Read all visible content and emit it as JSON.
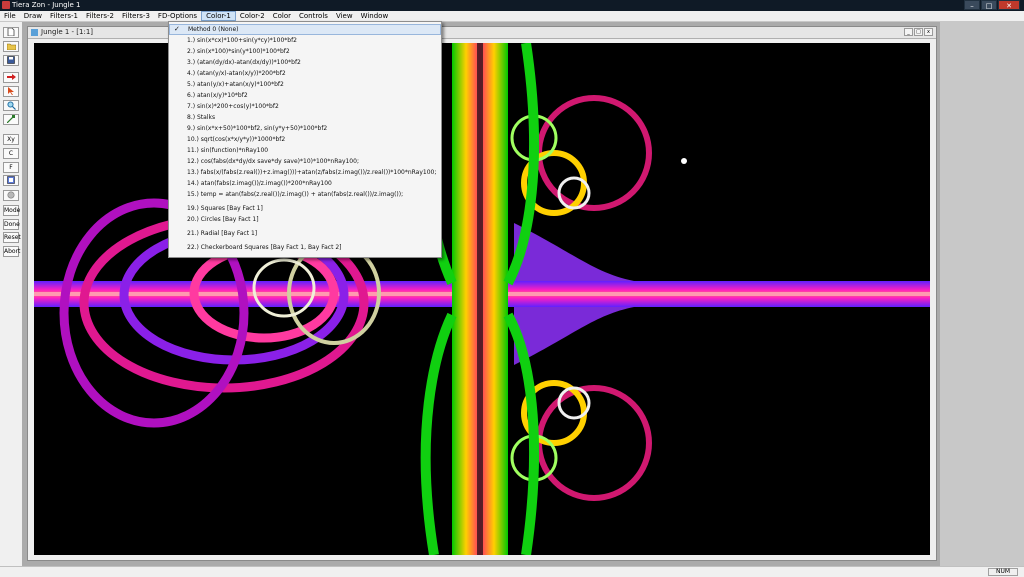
{
  "window": {
    "title": "Tiera Zon - Jungle 1",
    "min": "–",
    "max": "□",
    "close": "✕"
  },
  "menubar": [
    "File",
    "Draw",
    "Filters-1",
    "Filters-2",
    "Filters-3",
    "FD-Options",
    "Color-1",
    "Color-2",
    "Color",
    "Controls",
    "View",
    "Window"
  ],
  "toolbar": [
    "",
    "",
    "",
    "",
    "",
    "",
    "",
    "Xy",
    "C",
    "F",
    "",
    "",
    "Mode",
    "Done",
    "Reset",
    "Abort"
  ],
  "document": {
    "title": "Jungle 1 - [1:1]"
  },
  "color1_menu": {
    "items": [
      "Method 0 (None)",
      "1.) sin(x*cx)*100+sin(y*cy)*100*bf2",
      "2.) sin(x*100)*sin(y*100)*100*bf2",
      "3.) (atan(dy/dx)-atan(dx/dy))*100*bf2",
      "4.) (atan(y/x)-atan(x/y))*200*bf2",
      "5.) atan(y/x)+atan(x/y)*100*bf2",
      "6.) atan(x/y)*10*bf2",
      "7.) sin(x)*200+cos(y)*100*bf2",
      "8.) Stalks",
      "9.) sin(x*x+50)*100*bf2, sin(y*y+50)*100*bf2",
      "10.) sqrt(cos(x*x/y*y))*1000*bf2",
      "11.) sin(function)*nRay100",
      "12.) cos(fabs(dx*dy/dx save*dy save)*10)*100*nRay100;",
      "13.) fabs(x/(fabs(z.real())+z.imag()))+atan(z/fabs(z.imag())/z.real())*100*nRay100;",
      "14.) atan(fabs(z.imag())/z.imag())*200*nRay100",
      "15.) temp = atan(fabs(z.real())/z.imag()) + atan(fabs(z.real())/z.imag());",
      "19.) Squares [Bay Fact 1]",
      "20.) Circles [Bay Fact 1]",
      "21.) Radial [Bay Fact 1]",
      "22.) Checkerboard Squares [Bay Fact 1, Bay Fact 2]"
    ],
    "checked_index": 0,
    "check_glyph": "✓"
  },
  "statusbar": {
    "mode": "NUM"
  },
  "colors": {
    "titlebar": "#0f1a26",
    "canvas_bg": "#000000",
    "menu_highlight": "#cfe3f7"
  }
}
